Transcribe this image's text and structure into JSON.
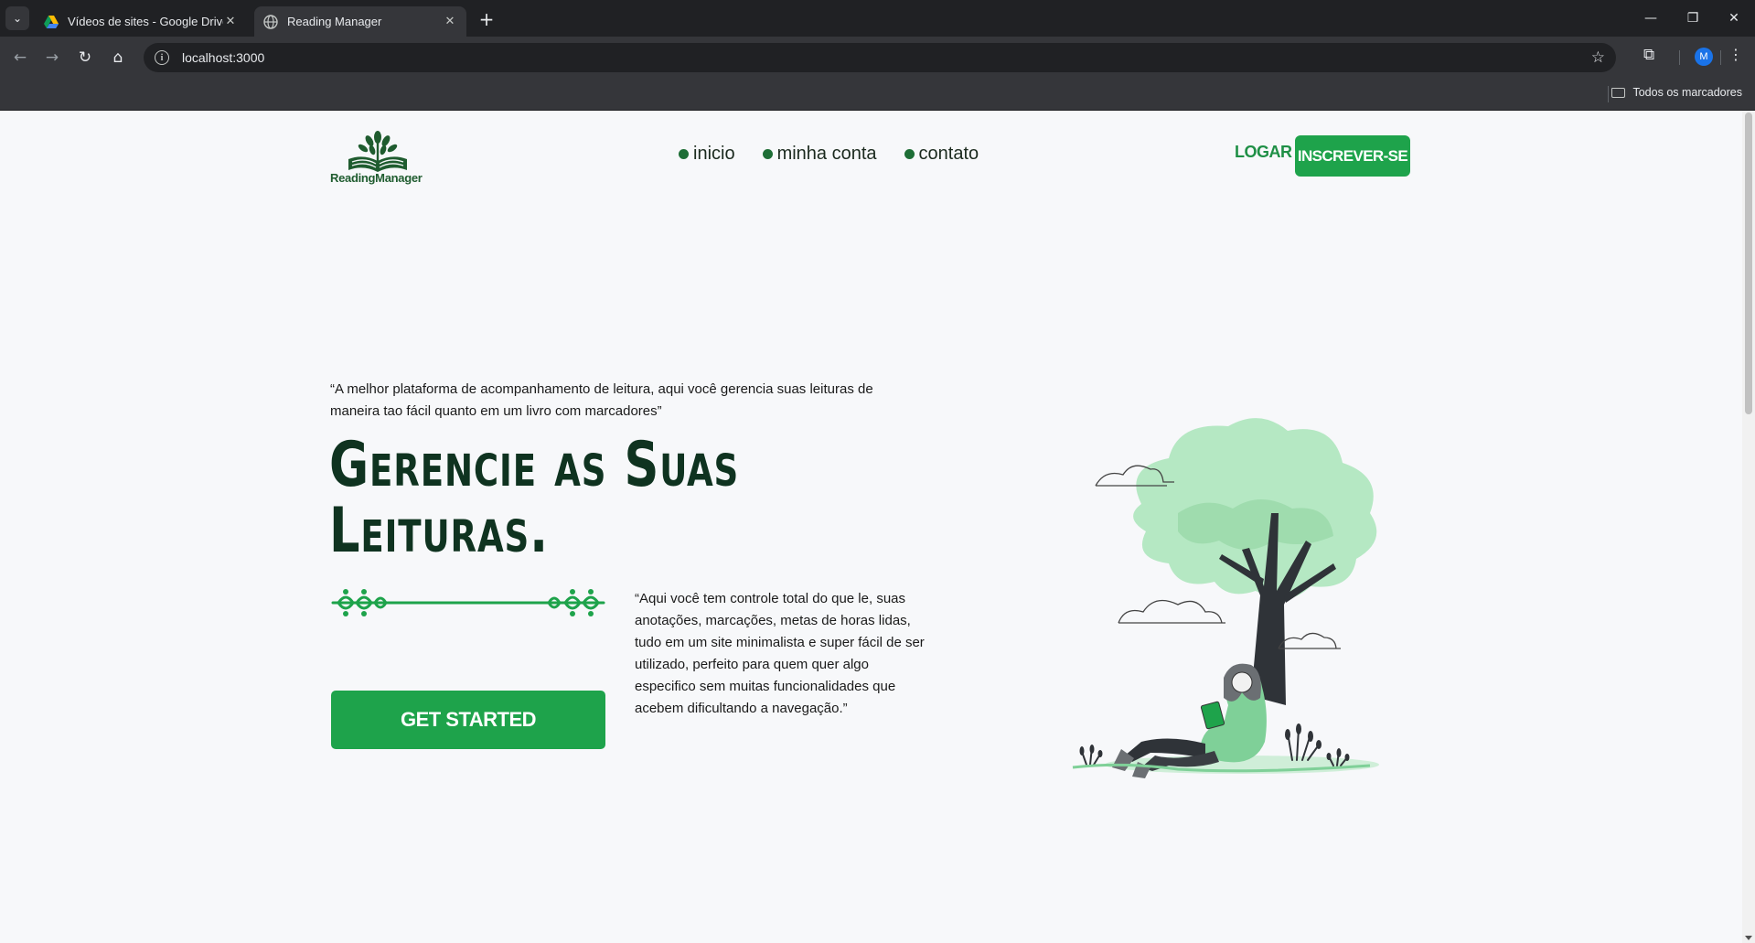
{
  "browser": {
    "tabs": [
      {
        "title": "Vídeos de sites - Google Drive",
        "active": false
      },
      {
        "title": "Reading Manager",
        "active": true
      }
    ],
    "url": "localhost:3000",
    "profile_initial": "M",
    "bookmarks_all": "Todos os marcadores"
  },
  "site": {
    "logo_text": "ReadingManager",
    "nav": [
      {
        "label": "inicio"
      },
      {
        "label": "minha conta"
      },
      {
        "label": "contato"
      }
    ],
    "login_label": "LOGAR",
    "signup_label": "INSCREVER-SE"
  },
  "hero": {
    "intro_quote": "“A melhor plataforma de acompanhamento de leitura, aqui você gerencia suas leituras de maneira tao fácil quanto em um livro com marcadores”",
    "headline": "Gerencie as Suas Leituras.",
    "cta_label": "GET STARTED",
    "description": "“Aqui você tem controle total do que le, suas anotações, marcações, metas de horas lidas, tudo em um site minimalista e super fácil de ser utilizado, perfeito para quem quer algo especifico sem muitas funcionalidades que acebem dificultando a navegação.”"
  },
  "colors": {
    "brand_green": "#1ea34b",
    "dark_green": "#0f3320",
    "nav_dot": "#1e6e36",
    "tree_light": "#b5e8c3"
  },
  "icons": [
    "drive-icon",
    "globe-icon",
    "close-icon",
    "plus-icon",
    "back-icon",
    "forward-icon",
    "reload-icon",
    "home-icon",
    "info-icon",
    "star-icon",
    "extensions-icon",
    "menu-icon",
    "folder-icon"
  ]
}
